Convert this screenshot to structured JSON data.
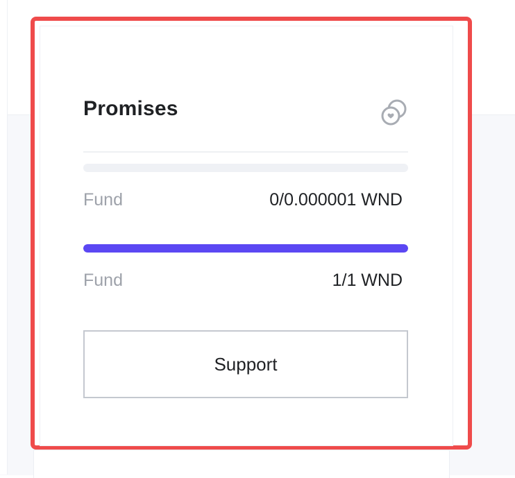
{
  "card": {
    "title": "Promises",
    "icon": "coins-icon",
    "rows": [
      {
        "label": "Fund",
        "value": "0/0.000001 WND",
        "progress": 0
      },
      {
        "label": "Fund",
        "value": "1/1 WND",
        "progress": 1
      }
    ],
    "support_label": "Support"
  },
  "colors": {
    "highlight": "#ef4b4b",
    "progress_fill": "#5b47f3",
    "progress_track": "#eff1f5",
    "label_muted": "#9ea2aa",
    "text_primary": "#1f2124"
  }
}
